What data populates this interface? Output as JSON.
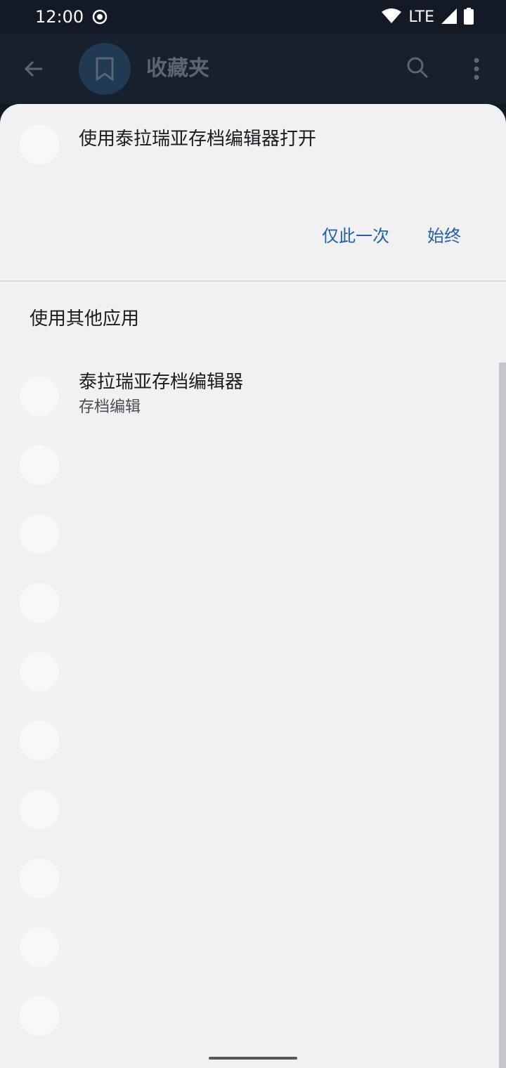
{
  "status_bar": {
    "time": "12:00",
    "network": "LTE"
  },
  "app_bar": {
    "title": "收藏夹"
  },
  "sheet": {
    "title": "使用泰拉瑞亚存档编辑器打开",
    "buttons": {
      "once": "仅此一次",
      "always": "始终"
    },
    "other_apps_label": "使用其他应用",
    "apps": [
      {
        "name": "泰拉瑞亚存档编辑器",
        "subtitle": "存档编辑"
      },
      {
        "name": "",
        "subtitle": ""
      },
      {
        "name": "",
        "subtitle": ""
      },
      {
        "name": "",
        "subtitle": ""
      },
      {
        "name": "",
        "subtitle": ""
      },
      {
        "name": "",
        "subtitle": ""
      },
      {
        "name": "",
        "subtitle": ""
      },
      {
        "name": "",
        "subtitle": ""
      },
      {
        "name": "",
        "subtitle": ""
      },
      {
        "name": "",
        "subtitle": ""
      }
    ]
  },
  "colors": {
    "accent": "#2260ad",
    "sheet_background": "#f1f1f4",
    "status_bar": "#131a25"
  }
}
